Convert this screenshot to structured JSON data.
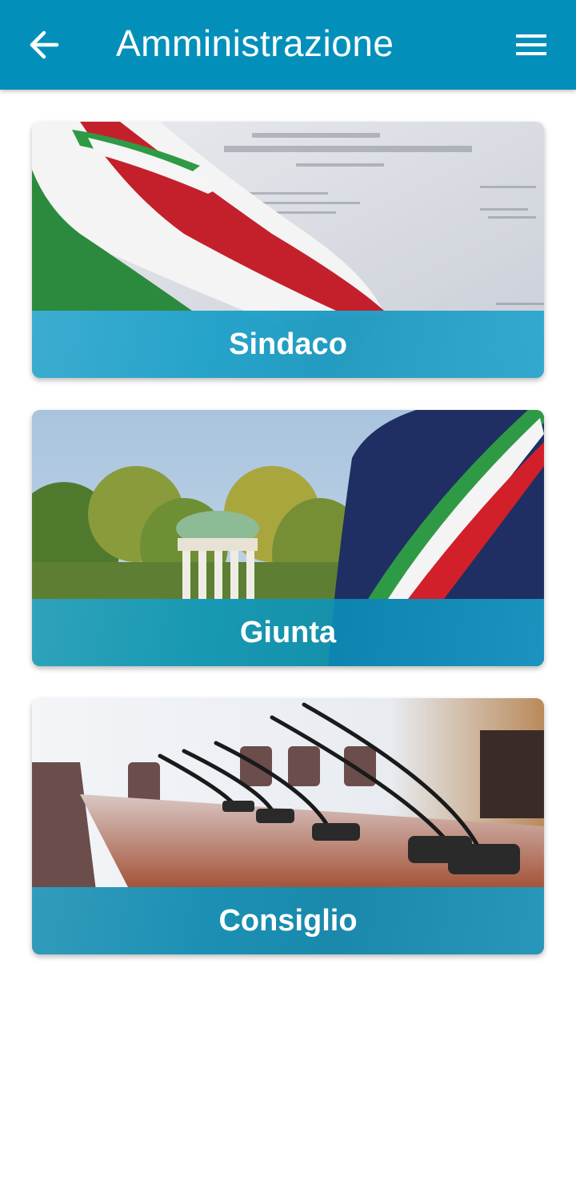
{
  "appbar": {
    "title": "Amministrazione",
    "back_icon": "arrow-left-icon",
    "menu_icon": "hamburger-menu-icon",
    "background_color": "#0290bb"
  },
  "cards": [
    {
      "label": "Sindaco",
      "image": "tricolor-sash-on-register-document"
    },
    {
      "label": "Giunta",
      "image": "mayor-with-tricolor-sash-and-park-gazebo"
    },
    {
      "label": "Consiglio",
      "image": "council-chamber-microphones"
    }
  ],
  "colors": {
    "accent": "#0290bb",
    "card_band": "#1a9fc8",
    "text_on_accent": "#ffffff"
  }
}
